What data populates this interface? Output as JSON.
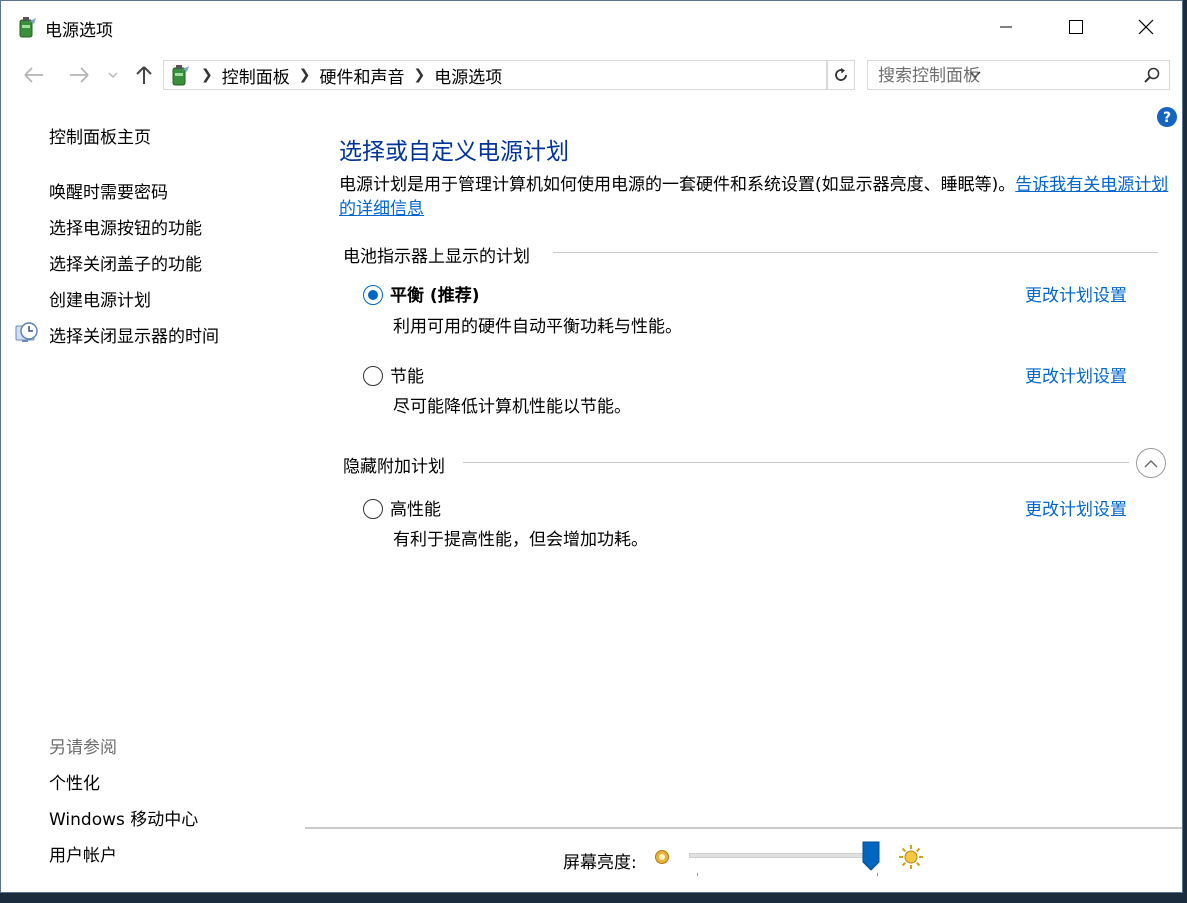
{
  "window": {
    "title": "电源选项"
  },
  "address": {
    "crumbs": [
      "控制面板",
      "硬件和声音",
      "电源选项"
    ],
    "search_placeholder": "搜索控制面板"
  },
  "sidebar": {
    "home": "控制面板主页",
    "items": [
      "唤醒时需要密码",
      "选择电源按钮的功能",
      "选择关闭盖子的功能",
      "创建电源计划",
      "选择关闭显示器的时间"
    ],
    "see_also_heading": "另请参阅",
    "see_also": [
      "个性化",
      "Windows 移动中心",
      "用户帐户"
    ]
  },
  "main": {
    "title": "选择或自定义电源计划",
    "description": "电源计划是用于管理计算机如何使用电源的一套硬件和系统设置(如显示器亮度、睡眠等)。",
    "description_link": "告诉我有关电源计划的详细信息",
    "battery_group_heading": "电池指示器上显示的计划",
    "hidden_group_heading": "隐藏附加计划",
    "change_link": "更改计划设置",
    "plans": [
      {
        "name": "平衡 (推荐)",
        "desc": "利用可用的硬件自动平衡功耗与性能。",
        "selected": true
      },
      {
        "name": "节能",
        "desc": "尽可能降低计算机性能以节能。",
        "selected": false
      },
      {
        "name": "高性能",
        "desc": "有利于提高性能，但会增加功耗。",
        "selected": false
      }
    ]
  },
  "brightness": {
    "label": "屏幕亮度:",
    "level_percent": 100
  },
  "colors": {
    "link": "#0066cc",
    "title": "#003399",
    "accent": "#0067c0"
  }
}
